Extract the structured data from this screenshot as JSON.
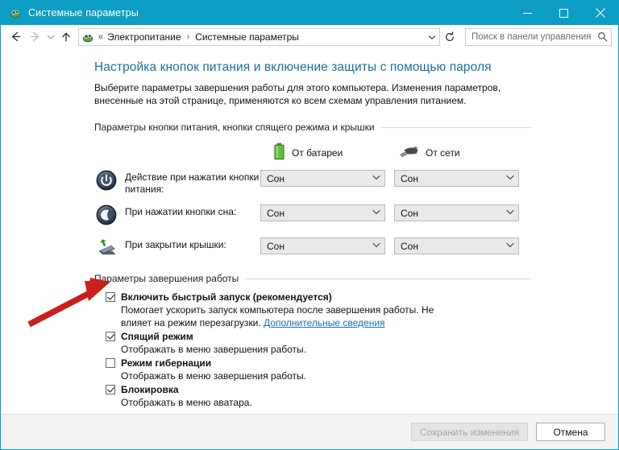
{
  "window": {
    "title": "Системные параметры",
    "title_icon": "power-options-icon",
    "accent_color": "#0d9dc4",
    "controls": {
      "minimize": "minimize-icon",
      "maximize": "maximize-icon",
      "close": "close-icon"
    }
  },
  "navbar": {
    "back": "back-arrow-icon",
    "forward": "forward-arrow-icon",
    "recent": "chevron-down-icon",
    "up": "up-arrow-icon",
    "address_icon": "power-options-icon",
    "breadcrumb_lead": "«",
    "breadcrumbs": [
      "Электропитание",
      "Системные параметры"
    ],
    "breadcrumb_separator": "›",
    "address_dropdown": "chevron-down-icon",
    "refresh": "refresh-icon",
    "search_placeholder": "Поиск в панели управления",
    "search_value": "",
    "search_icon": "search-icon"
  },
  "page": {
    "title": "Настройка кнопок питания и включение защиты с помощью пароля",
    "description": "Выберите параметры завершения работы для этого компьютера. Изменения параметров, внесенные на этой странице, применяются ко всем схемам управления питанием."
  },
  "power_buttons_group": {
    "heading": "Параметры кнопки питания, кнопки спящего режима и крышки",
    "columns": [
      {
        "label": "От батареи",
        "icon": "battery-icon"
      },
      {
        "label": "От сети",
        "icon": "power-plug-icon"
      }
    ],
    "rows": [
      {
        "icon": "power-button-icon",
        "label": "Действие при нажатии кнопки питания:",
        "battery_value": "Сон",
        "ac_value": "Сон"
      },
      {
        "icon": "sleep-moon-icon",
        "label": "При нажатии кнопки сна:",
        "battery_value": "Сон",
        "ac_value": "Сон"
      },
      {
        "icon": "laptop-lid-icon",
        "label": "При закрытии крышки:",
        "battery_value": "Сон",
        "ac_value": "Сон"
      }
    ]
  },
  "shutdown_group": {
    "heading": "Параметры завершения работы",
    "items": [
      {
        "title": "Включить быстрый запуск (рекомендуется)",
        "checked": true,
        "description": "Помогает ускорить запуск компьютера после завершения работы. Не влияет на режим перезагрузки.",
        "link": "Дополнительные сведения"
      },
      {
        "title": "Спящий режим",
        "checked": true,
        "description": "Отображать в меню завершения работы.",
        "link": ""
      },
      {
        "title": "Режим гибернации",
        "checked": false,
        "description": "Отображать в меню завершения работы.",
        "link": ""
      },
      {
        "title": "Блокировка",
        "checked": true,
        "description": "Отображать в меню аватара.",
        "link": ""
      }
    ]
  },
  "footer": {
    "save_label": "Сохранить изменения",
    "save_enabled": false,
    "cancel_label": "Отмена"
  },
  "annotation": {
    "type": "red-arrow",
    "color": "#c9201b",
    "points_to": "fast-startup-checkbox"
  }
}
